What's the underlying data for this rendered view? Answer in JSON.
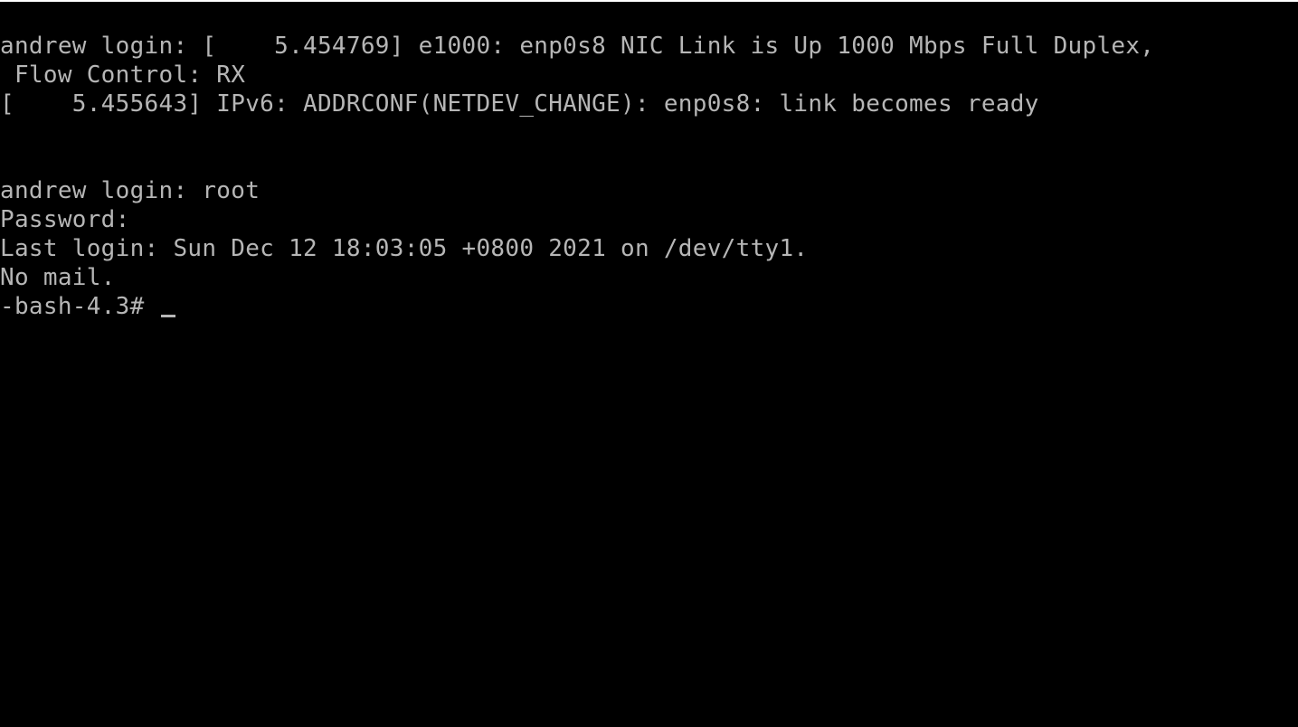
{
  "terminal": {
    "lines": [
      "andrew login: [    5.454769] e1000: enp0s8 NIC Link is Up 1000 Mbps Full Duplex,",
      " Flow Control: RX",
      "[    5.455643] IPv6: ADDRCONF(NETDEV_CHANGE): enp0s8: link becomes ready",
      "",
      "",
      "andrew login: root",
      "Password:",
      "Last login: Sun Dec 12 18:03:05 +0800 2021 on /dev/tty1.",
      "No mail."
    ],
    "prompt": "-bash-4.3# ",
    "colors": {
      "background": "#000000",
      "foreground": "#b6b6b6"
    }
  }
}
